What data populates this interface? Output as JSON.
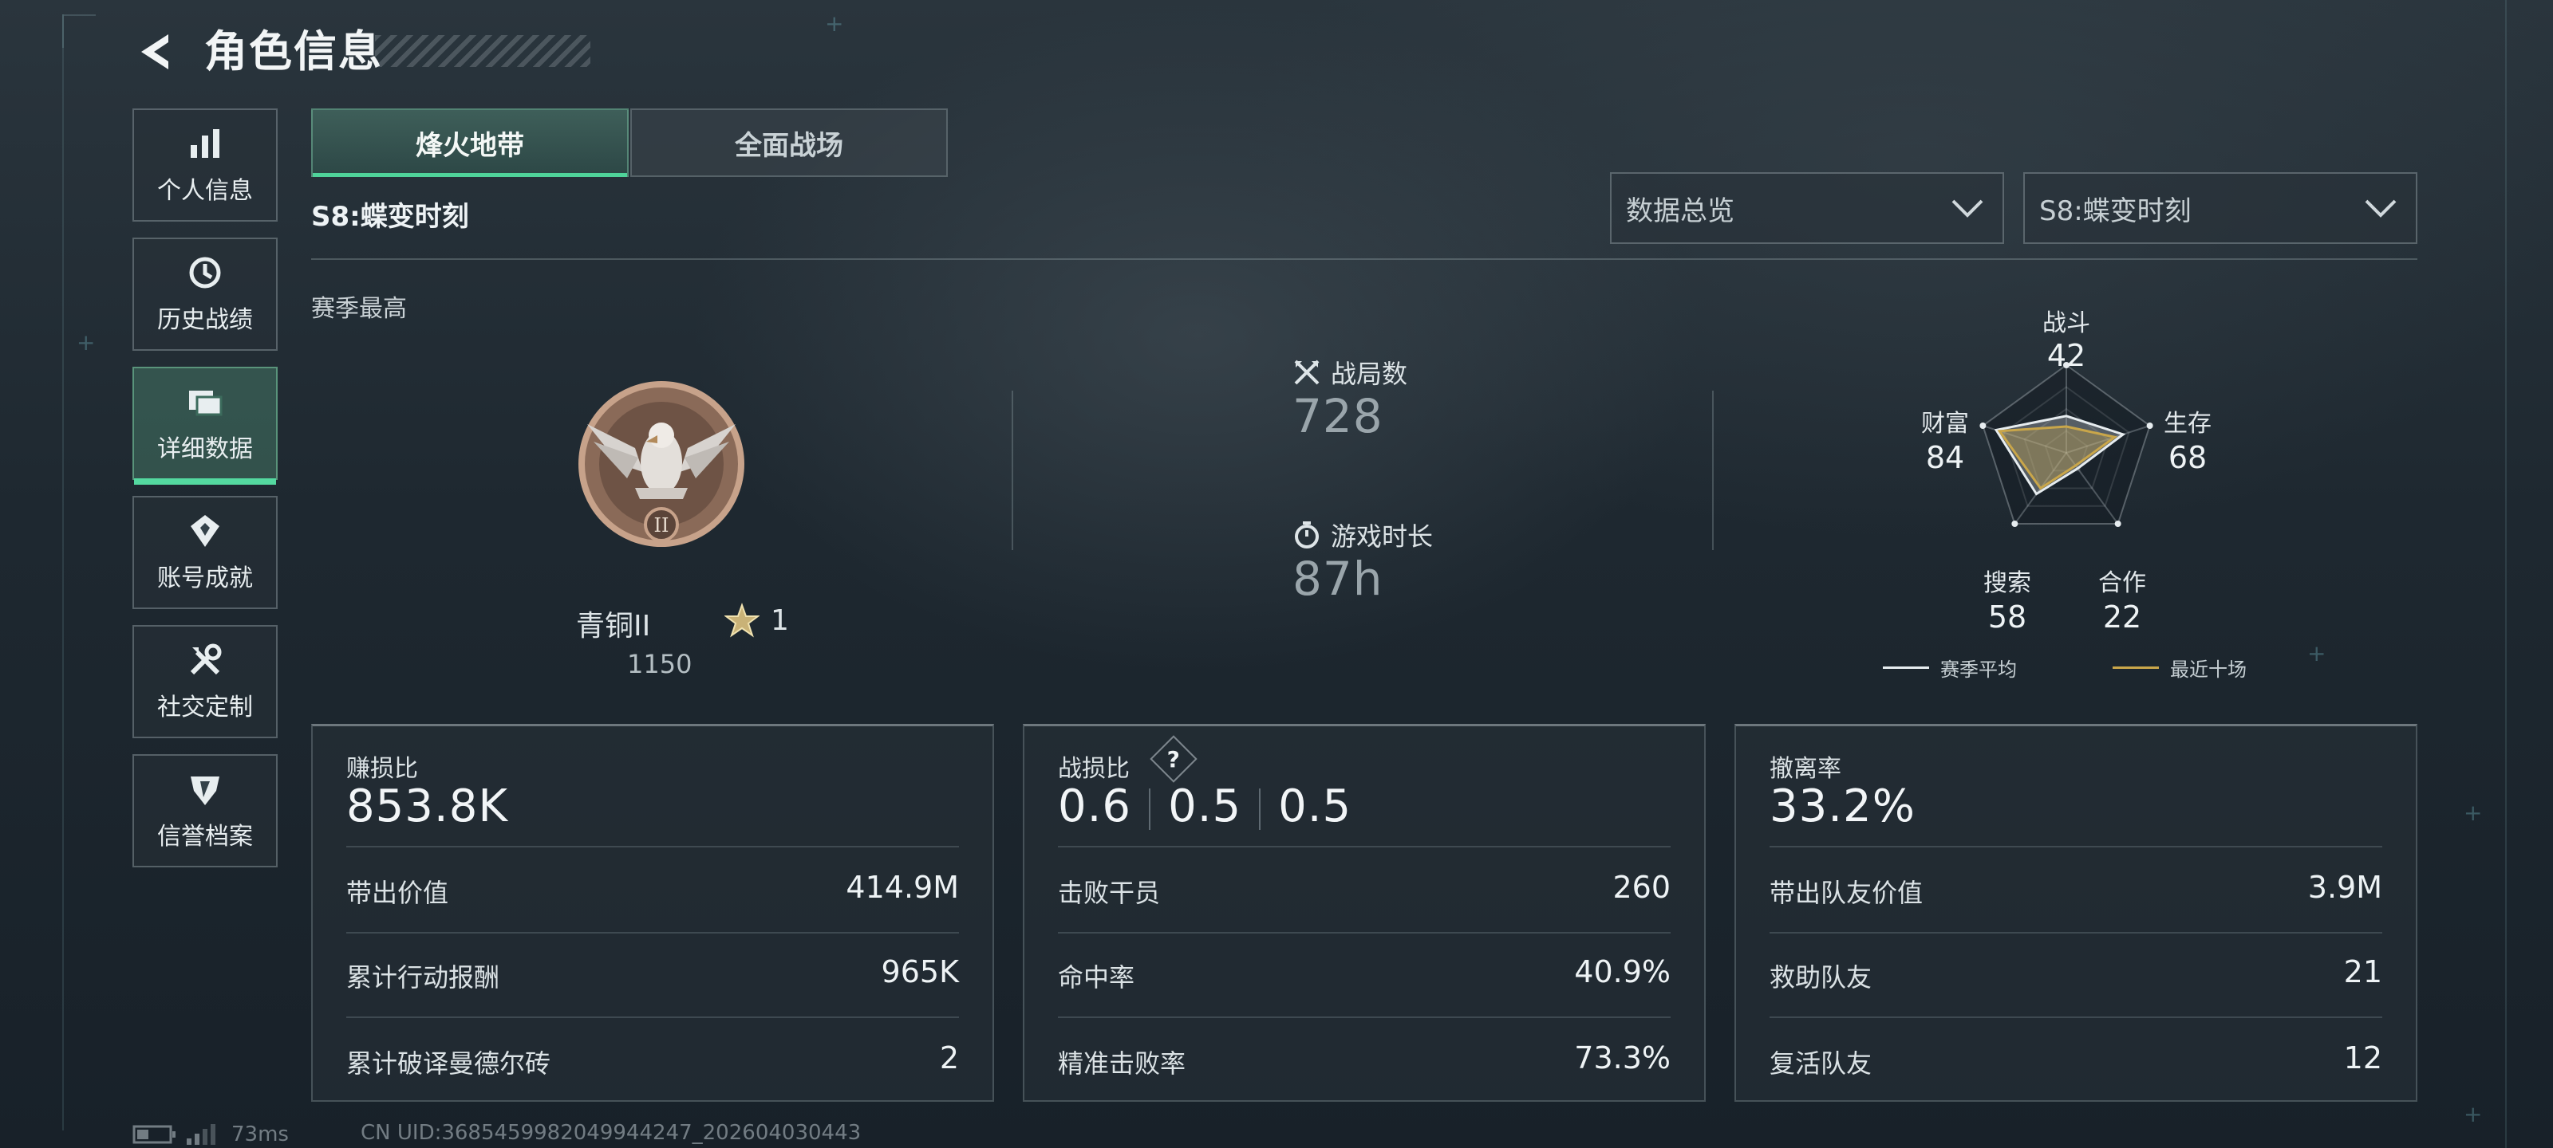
{
  "header": {
    "title": "角色信息"
  },
  "sidebar": {
    "items": [
      {
        "label": "个人信息",
        "icon": "bar-chart-icon"
      },
      {
        "label": "历史战绩",
        "icon": "history-icon"
      },
      {
        "label": "详细数据",
        "icon": "cards-icon",
        "active": true
      },
      {
        "label": "账号成就",
        "icon": "badge-icon"
      },
      {
        "label": "社交定制",
        "icon": "tools-icon"
      },
      {
        "label": "信誉档案",
        "icon": "shield-icon"
      }
    ]
  },
  "tabs": [
    {
      "label": "烽火地带",
      "active": true
    },
    {
      "label": "全面战场",
      "active": false
    }
  ],
  "season": {
    "title": "S8:蝶变时刻",
    "best_label": "赛季最高"
  },
  "filters": {
    "overview": {
      "value": "数据总览"
    },
    "season": {
      "value": "S8:蝶变时刻"
    }
  },
  "rank": {
    "name": "青铜II",
    "stars": "1",
    "score": "1150",
    "emblem": "eagle-rank-emblem-icon"
  },
  "stats": {
    "matches": {
      "label": "战局数",
      "value": "728",
      "icon": "crossed-swords-icon"
    },
    "playtime": {
      "label": "游戏时长",
      "value": "87h",
      "icon": "stopwatch-icon"
    }
  },
  "radar": {
    "axes": [
      {
        "label": "战斗",
        "value": "42",
        "season_avg": 42,
        "recent": 30
      },
      {
        "label": "生存",
        "value": "68",
        "season_avg": 68,
        "recent": 58
      },
      {
        "label": "合作",
        "value": "22",
        "season_avg": 22,
        "recent": 18
      },
      {
        "label": "搜索",
        "value": "58",
        "season_avg": 58,
        "recent": 50
      },
      {
        "label": "财富",
        "value": "84",
        "season_avg": 84,
        "recent": 80
      }
    ],
    "legend": {
      "season_avg": "赛季平均",
      "recent": "最近十场"
    },
    "colors": {
      "season_avg": "#e6ecef",
      "recent": "#c9a64a"
    }
  },
  "panels": {
    "profit": {
      "title": "赚损比",
      "value": "853.8K",
      "rows": [
        {
          "label": "带出价值",
          "value": "414.9M"
        },
        {
          "label": "累计行动报酬",
          "value": "965K"
        },
        {
          "label": "累计破译曼德尔砖",
          "value": "2"
        }
      ]
    },
    "kd": {
      "title": "战损比",
      "help": "?",
      "values": [
        "0.6",
        "0.5",
        "0.5"
      ],
      "rows": [
        {
          "label": "击败干员",
          "value": "260"
        },
        {
          "label": "命中率",
          "value": "40.9%"
        },
        {
          "label": "精准击败率",
          "value": "73.3%"
        }
      ]
    },
    "extract": {
      "title": "撤离率",
      "value": "33.2%",
      "rows": [
        {
          "label": "带出队友价值",
          "value": "3.9M"
        },
        {
          "label": "救助队友",
          "value": "21"
        },
        {
          "label": "复活队友",
          "value": "12"
        }
      ]
    }
  },
  "footer": {
    "ping": "73ms",
    "uid": "CN UID:3685459982049944247_202604030443"
  }
}
